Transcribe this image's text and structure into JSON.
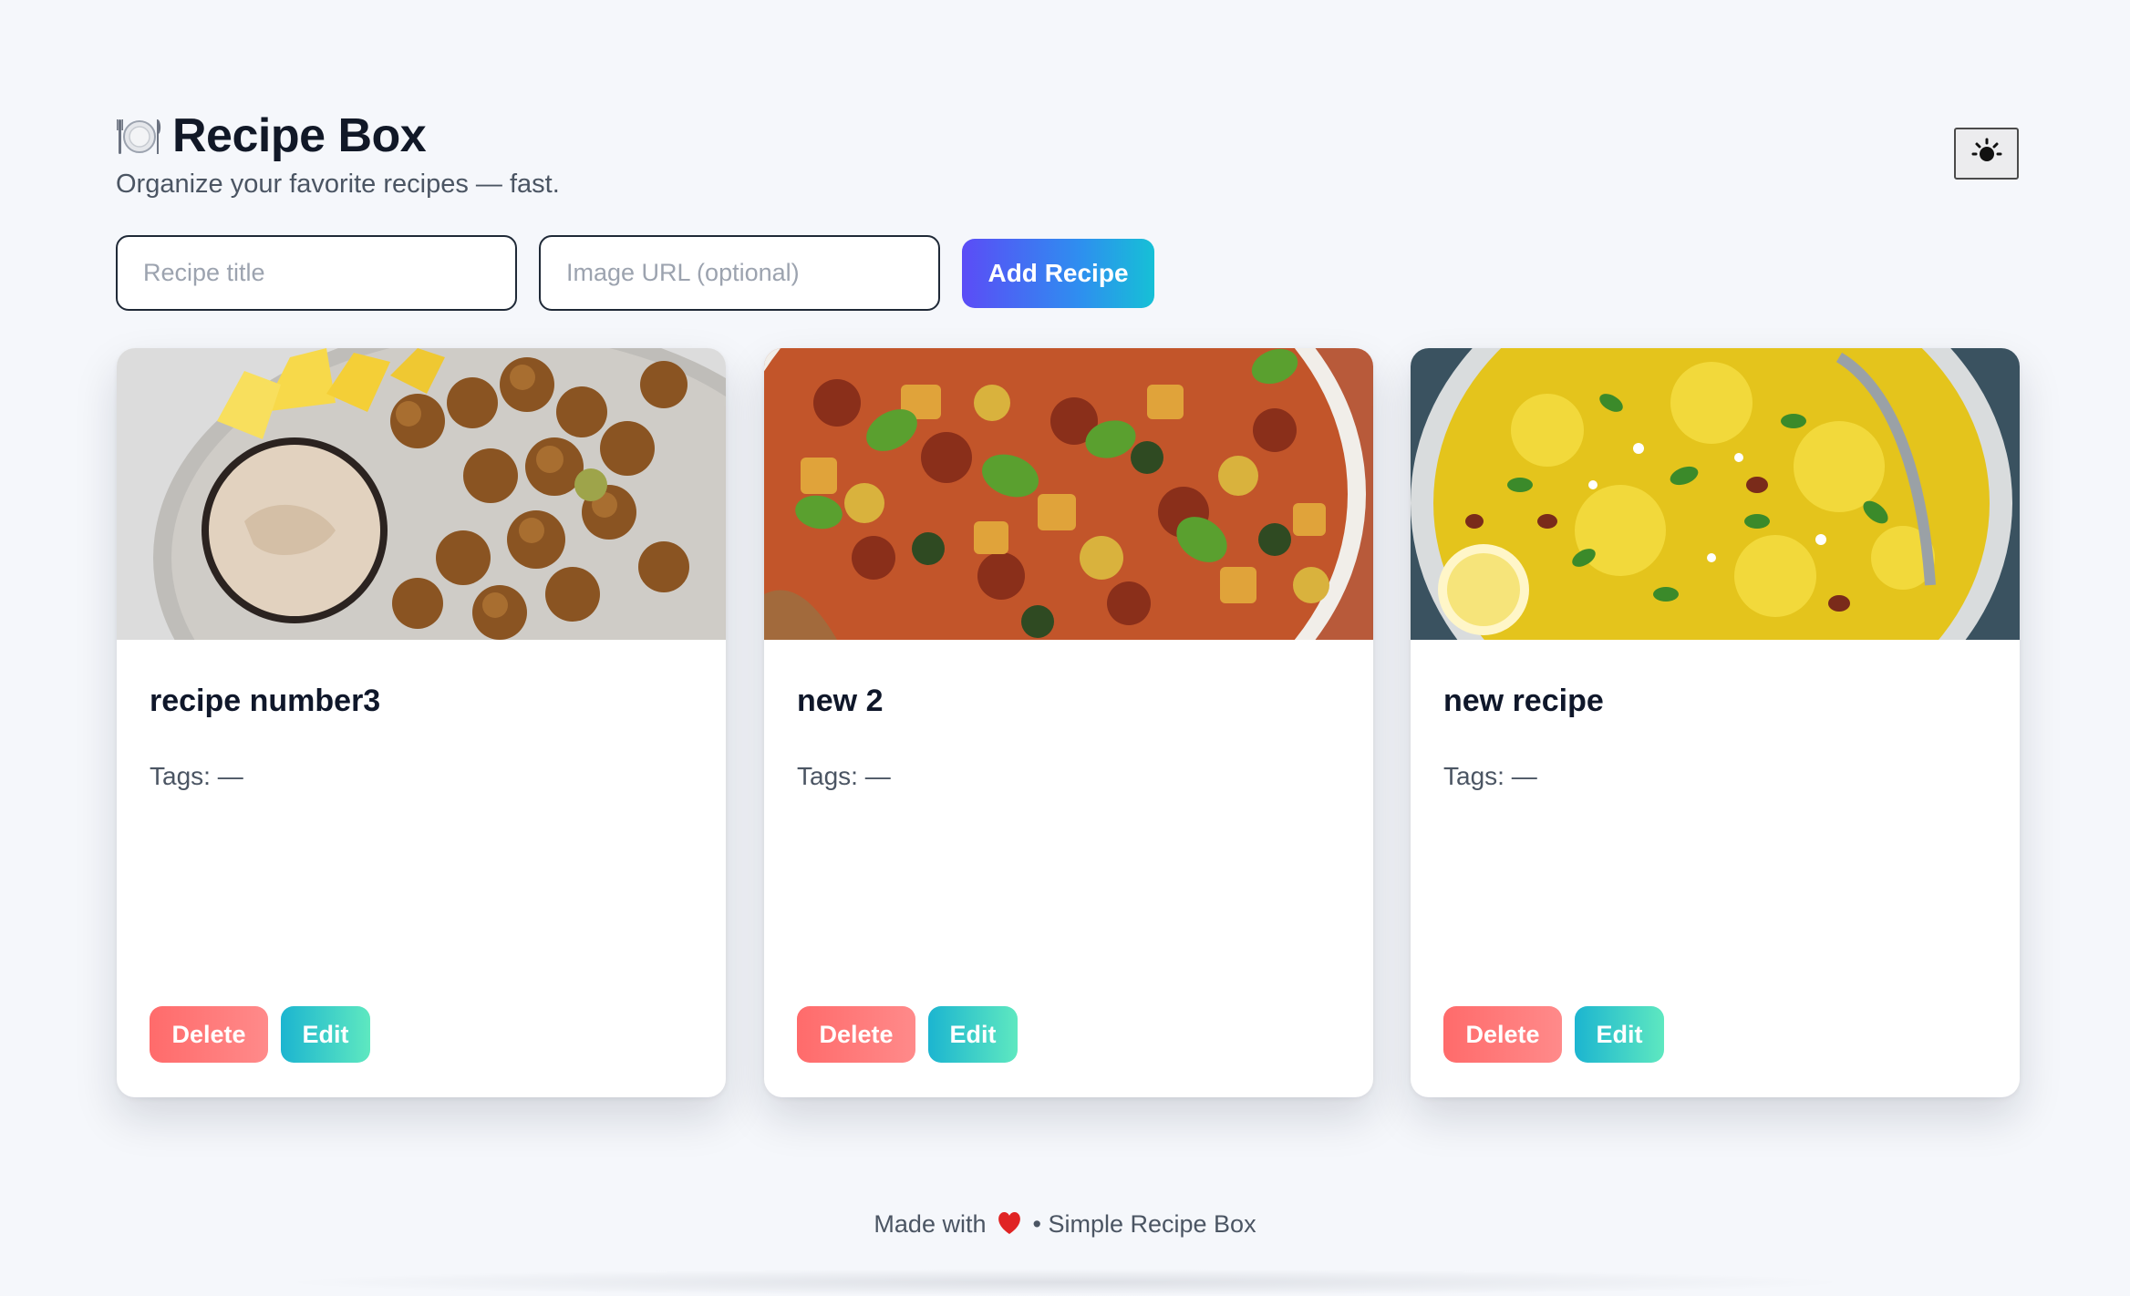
{
  "header": {
    "title": "Recipe Box",
    "icon": "plate-cutlery-icon",
    "subtitle": "Organize your favorite recipes — fast.",
    "theme_toggle_icon": "sun-icon"
  },
  "form": {
    "title_placeholder": "Recipe title",
    "url_placeholder": "Image URL (optional)",
    "add_label": "Add Recipe"
  },
  "recipes": [
    {
      "title": "recipe number3",
      "tags": "Tags: —",
      "image": "falafel-with-dip-photo",
      "delete_label": "Delete",
      "edit_label": "Edit"
    },
    {
      "title": "new 2",
      "tags": "Tags: —",
      "image": "ratatouille-vegetables-photo",
      "delete_label": "Delete",
      "edit_label": "Edit"
    },
    {
      "title": "new recipe",
      "tags": "Tags: —",
      "image": "poha-yellow-rice-photo",
      "delete_label": "Delete",
      "edit_label": "Edit"
    }
  ],
  "footer": {
    "made_with": "Made with",
    "heart_icon": "heart-icon",
    "rest": "• Simple Recipe Box"
  },
  "colors": {
    "background": "#f5f7fb",
    "add_gradient_start": "#5b4cf6",
    "add_gradient_end": "#16c0d6",
    "delete": "#ff6b6b",
    "edit_start": "#1cb5d0",
    "edit_end": "#5ee8c0"
  }
}
